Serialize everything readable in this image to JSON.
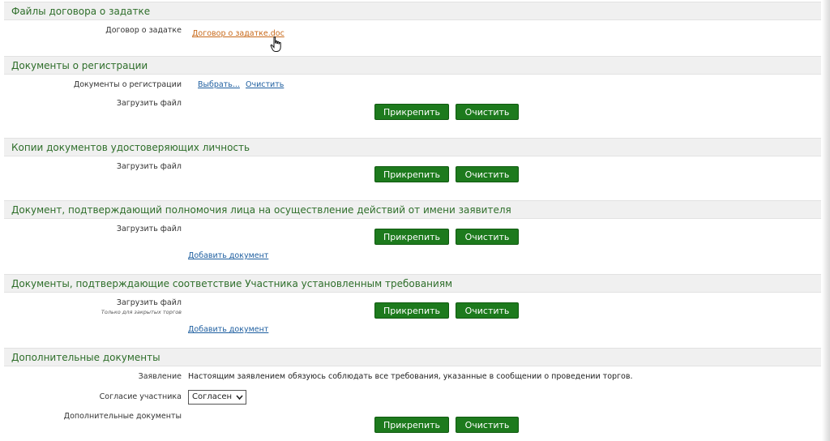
{
  "sections": [
    {
      "title": "Файлы договора о задатке",
      "label": "Договор о задатке",
      "file_link": "Договор о задатке.doc"
    },
    {
      "title": "Документы о регистрации",
      "label": "Документы о регистрации",
      "select_link": "Выбрать...",
      "clear_link": "Очистить",
      "upload_label": "Загрузить файл",
      "attach_label": "Прикрепить",
      "clear_label": "Очистить"
    },
    {
      "title": "Копии документов удостоверяющих личность",
      "upload_label": "Загрузить файл",
      "attach_label": "Прикрепить",
      "clear_label": "Очистить"
    },
    {
      "title": "Документ, подтверждающий полномочия лица на осуществление действий от имени заявителя",
      "upload_label": "Загрузить файл",
      "attach_label": "Прикрепить",
      "clear_label": "Очистить",
      "add_link": "Добавить документ"
    },
    {
      "title": "Документы, подтверждающие соответствие Участника установленным требованиям",
      "upload_label": "Загрузить файл",
      "upload_note": "Только для закрытых торгов",
      "attach_label": "Прикрепить",
      "clear_label": "Очистить",
      "add_link": "Добавить документ"
    },
    {
      "title": "Дополнительные документы",
      "statement_label": "Заявление",
      "statement_text": "Настоящим заявлением обязуюсь соблюдать все требования, указанные в сообщении о проведении торгов.",
      "consent_label": "Согласие участника",
      "consent_value": "Согласен",
      "extra_docs_label": "Дополнительные документы",
      "attach_label": "Прикрепить",
      "clear_label": "Очистить"
    }
  ],
  "colors": {
    "section_title": "#2e6e2a",
    "button": "#1d7a1d",
    "link": "#1f5fa0",
    "visited_link": "#c8691a"
  }
}
